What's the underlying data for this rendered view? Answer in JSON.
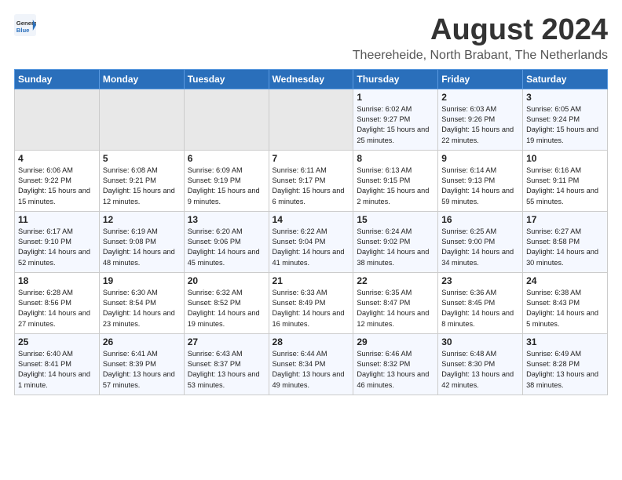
{
  "header": {
    "logo_general": "General",
    "logo_blue": "Blue",
    "month_title": "August 2024",
    "location": "Theereheide, North Brabant, The Netherlands"
  },
  "weekdays": [
    "Sunday",
    "Monday",
    "Tuesday",
    "Wednesday",
    "Thursday",
    "Friday",
    "Saturday"
  ],
  "weeks": [
    [
      {
        "day": "",
        "empty": true
      },
      {
        "day": "",
        "empty": true
      },
      {
        "day": "",
        "empty": true
      },
      {
        "day": "",
        "empty": true
      },
      {
        "day": "1",
        "sunrise": "Sunrise: 6:02 AM",
        "sunset": "Sunset: 9:27 PM",
        "daylight": "Daylight: 15 hours and 25 minutes."
      },
      {
        "day": "2",
        "sunrise": "Sunrise: 6:03 AM",
        "sunset": "Sunset: 9:26 PM",
        "daylight": "Daylight: 15 hours and 22 minutes."
      },
      {
        "day": "3",
        "sunrise": "Sunrise: 6:05 AM",
        "sunset": "Sunset: 9:24 PM",
        "daylight": "Daylight: 15 hours and 19 minutes."
      }
    ],
    [
      {
        "day": "4",
        "sunrise": "Sunrise: 6:06 AM",
        "sunset": "Sunset: 9:22 PM",
        "daylight": "Daylight: 15 hours and 15 minutes."
      },
      {
        "day": "5",
        "sunrise": "Sunrise: 6:08 AM",
        "sunset": "Sunset: 9:21 PM",
        "daylight": "Daylight: 15 hours and 12 minutes."
      },
      {
        "day": "6",
        "sunrise": "Sunrise: 6:09 AM",
        "sunset": "Sunset: 9:19 PM",
        "daylight": "Daylight: 15 hours and 9 minutes."
      },
      {
        "day": "7",
        "sunrise": "Sunrise: 6:11 AM",
        "sunset": "Sunset: 9:17 PM",
        "daylight": "Daylight: 15 hours and 6 minutes."
      },
      {
        "day": "8",
        "sunrise": "Sunrise: 6:13 AM",
        "sunset": "Sunset: 9:15 PM",
        "daylight": "Daylight: 15 hours and 2 minutes."
      },
      {
        "day": "9",
        "sunrise": "Sunrise: 6:14 AM",
        "sunset": "Sunset: 9:13 PM",
        "daylight": "Daylight: 14 hours and 59 minutes."
      },
      {
        "day": "10",
        "sunrise": "Sunrise: 6:16 AM",
        "sunset": "Sunset: 9:11 PM",
        "daylight": "Daylight: 14 hours and 55 minutes."
      }
    ],
    [
      {
        "day": "11",
        "sunrise": "Sunrise: 6:17 AM",
        "sunset": "Sunset: 9:10 PM",
        "daylight": "Daylight: 14 hours and 52 minutes."
      },
      {
        "day": "12",
        "sunrise": "Sunrise: 6:19 AM",
        "sunset": "Sunset: 9:08 PM",
        "daylight": "Daylight: 14 hours and 48 minutes."
      },
      {
        "day": "13",
        "sunrise": "Sunrise: 6:20 AM",
        "sunset": "Sunset: 9:06 PM",
        "daylight": "Daylight: 14 hours and 45 minutes."
      },
      {
        "day": "14",
        "sunrise": "Sunrise: 6:22 AM",
        "sunset": "Sunset: 9:04 PM",
        "daylight": "Daylight: 14 hours and 41 minutes."
      },
      {
        "day": "15",
        "sunrise": "Sunrise: 6:24 AM",
        "sunset": "Sunset: 9:02 PM",
        "daylight": "Daylight: 14 hours and 38 minutes."
      },
      {
        "day": "16",
        "sunrise": "Sunrise: 6:25 AM",
        "sunset": "Sunset: 9:00 PM",
        "daylight": "Daylight: 14 hours and 34 minutes."
      },
      {
        "day": "17",
        "sunrise": "Sunrise: 6:27 AM",
        "sunset": "Sunset: 8:58 PM",
        "daylight": "Daylight: 14 hours and 30 minutes."
      }
    ],
    [
      {
        "day": "18",
        "sunrise": "Sunrise: 6:28 AM",
        "sunset": "Sunset: 8:56 PM",
        "daylight": "Daylight: 14 hours and 27 minutes."
      },
      {
        "day": "19",
        "sunrise": "Sunrise: 6:30 AM",
        "sunset": "Sunset: 8:54 PM",
        "daylight": "Daylight: 14 hours and 23 minutes."
      },
      {
        "day": "20",
        "sunrise": "Sunrise: 6:32 AM",
        "sunset": "Sunset: 8:52 PM",
        "daylight": "Daylight: 14 hours and 19 minutes."
      },
      {
        "day": "21",
        "sunrise": "Sunrise: 6:33 AM",
        "sunset": "Sunset: 8:49 PM",
        "daylight": "Daylight: 14 hours and 16 minutes."
      },
      {
        "day": "22",
        "sunrise": "Sunrise: 6:35 AM",
        "sunset": "Sunset: 8:47 PM",
        "daylight": "Daylight: 14 hours and 12 minutes."
      },
      {
        "day": "23",
        "sunrise": "Sunrise: 6:36 AM",
        "sunset": "Sunset: 8:45 PM",
        "daylight": "Daylight: 14 hours and 8 minutes."
      },
      {
        "day": "24",
        "sunrise": "Sunrise: 6:38 AM",
        "sunset": "Sunset: 8:43 PM",
        "daylight": "Daylight: 14 hours and 5 minutes."
      }
    ],
    [
      {
        "day": "25",
        "sunrise": "Sunrise: 6:40 AM",
        "sunset": "Sunset: 8:41 PM",
        "daylight": "Daylight: 14 hours and 1 minute."
      },
      {
        "day": "26",
        "sunrise": "Sunrise: 6:41 AM",
        "sunset": "Sunset: 8:39 PM",
        "daylight": "Daylight: 13 hours and 57 minutes."
      },
      {
        "day": "27",
        "sunrise": "Sunrise: 6:43 AM",
        "sunset": "Sunset: 8:37 PM",
        "daylight": "Daylight: 13 hours and 53 minutes."
      },
      {
        "day": "28",
        "sunrise": "Sunrise: 6:44 AM",
        "sunset": "Sunset: 8:34 PM",
        "daylight": "Daylight: 13 hours and 49 minutes."
      },
      {
        "day": "29",
        "sunrise": "Sunrise: 6:46 AM",
        "sunset": "Sunset: 8:32 PM",
        "daylight": "Daylight: 13 hours and 46 minutes."
      },
      {
        "day": "30",
        "sunrise": "Sunrise: 6:48 AM",
        "sunset": "Sunset: 8:30 PM",
        "daylight": "Daylight: 13 hours and 42 minutes."
      },
      {
        "day": "31",
        "sunrise": "Sunrise: 6:49 AM",
        "sunset": "Sunset: 8:28 PM",
        "daylight": "Daylight: 13 hours and 38 minutes."
      }
    ]
  ]
}
